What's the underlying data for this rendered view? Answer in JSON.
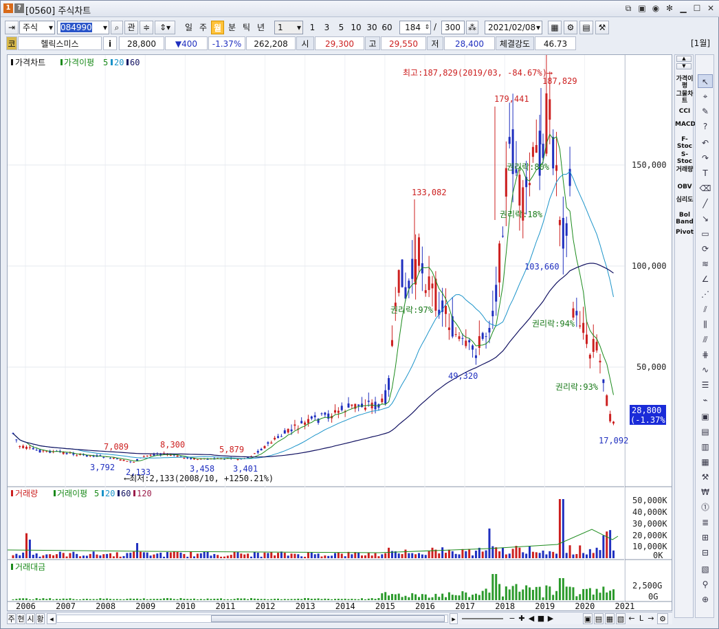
{
  "window": {
    "badge1": "1",
    "badge2": "?",
    "title": "[0560] 주식차트"
  },
  "toolbar": {
    "market": "주식",
    "code": "084990",
    "btn_gwan": "관",
    "periods": [
      "일",
      "주",
      "월",
      "분",
      "틱",
      "년"
    ],
    "active_period": "월",
    "interval": "1",
    "quick_intervals": [
      "1",
      "3",
      "5",
      "10",
      "30",
      "60"
    ],
    "count": "184",
    "count_sep": "/",
    "total": "300",
    "date": "2021/02/08"
  },
  "quote": {
    "code_label": "코",
    "name": "헬릭스미스",
    "info_btn": "i",
    "price": "28,800",
    "change": "▼400",
    "change_pct": "-1.37%",
    "volume": "262,208",
    "open_label": "시",
    "open": "29,300",
    "high_label": "고",
    "high": "29,550",
    "low_label": "저",
    "low": "28,400",
    "strength_label": "체결강도",
    "strength": "46.73",
    "period_tag": "[1월]"
  },
  "price_panel": {
    "legend": {
      "main": "가격차트",
      "ma_label": "가격이평",
      "ma_periods": [
        "5",
        "20",
        "60"
      ]
    },
    "y_ticks": [
      "150,000",
      "100,000",
      "50,000"
    ],
    "current_price_tag": "28,800",
    "current_change_tag": "(-1.37%)",
    "annotations": {
      "high_note": "최고:187,829(2019/03, -84.67%)⟶",
      "low_note": "⟵최저:2,133(2008/10, +1250.21%)",
      "labels": [
        "187,829",
        "179,441",
        "133,082",
        "103,660",
        "49,320",
        "17,092",
        "7,089",
        "8,300",
        "5,879",
        "3,792",
        "2,133",
        "3,458",
        "3,401"
      ],
      "rights": [
        "권리락:80%",
        "권리락:18%",
        "권리락:97%",
        "권리락:94%",
        "권리락:93%"
      ]
    }
  },
  "volume_panel": {
    "legend": {
      "main": "거래량",
      "ma_label": "거래이평",
      "ma_periods": [
        "5",
        "20",
        "60",
        "120"
      ]
    },
    "y_ticks": [
      "50,000K",
      "40,000K",
      "30,000K",
      "20,000K",
      "10,000K",
      "0K"
    ]
  },
  "amount_panel": {
    "legend": {
      "main": "거래대금"
    },
    "y_ticks": [
      "2,500G",
      "0G"
    ]
  },
  "x_axis": {
    "years": [
      "2006",
      "2007",
      "2008",
      "2009",
      "2010",
      "2011",
      "2012",
      "2013",
      "2014",
      "2015",
      "2016",
      "2017",
      "2018",
      "2019",
      "2020",
      "2021"
    ]
  },
  "indicators": [
    "가격이평",
    "그물차트",
    "CCI",
    "MACD",
    "F-Stoc",
    "S-Stoc",
    "거래량",
    "OBV",
    "심리도",
    "Bol Band",
    "Pivot"
  ],
  "bottom": {
    "tabs": [
      "주",
      "현",
      "시",
      "황"
    ]
  },
  "colors": {
    "up": "#cc1f1f",
    "down": "#1f2fbf",
    "ma5": "#1a8a1a",
    "ma20": "#1a93c9",
    "ma60": "#101060",
    "ma120": "#9b1c4a",
    "current_tag": "#1a2bd8",
    "rights": "#1a7a1a"
  }
}
